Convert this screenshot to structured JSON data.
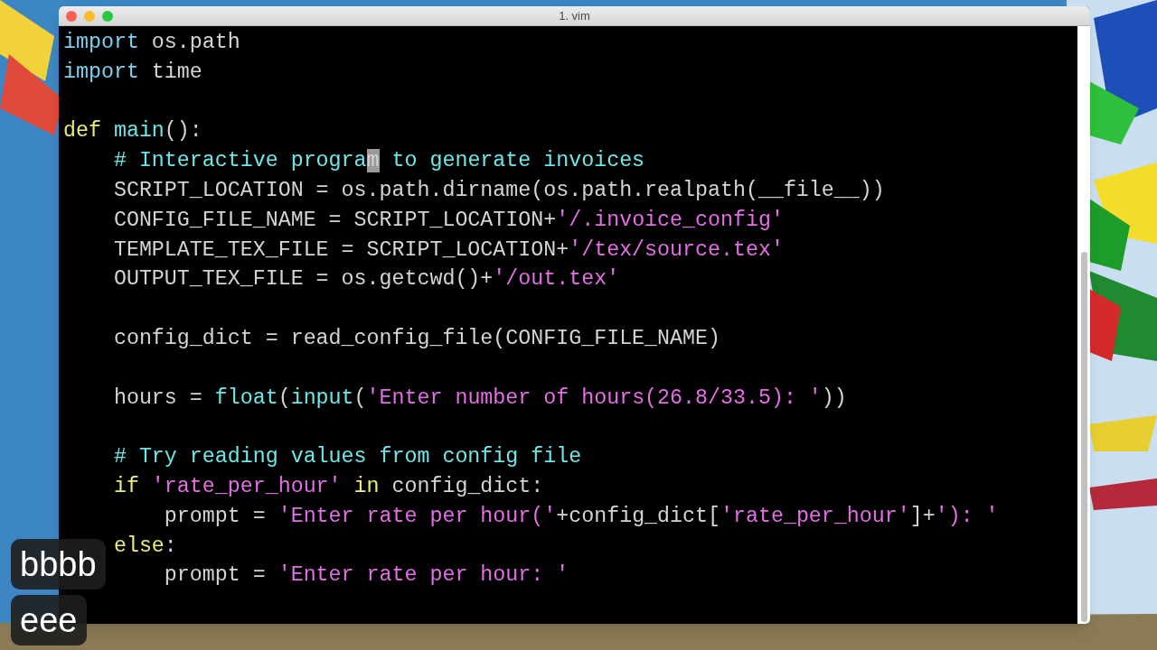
{
  "window": {
    "title": "1. vim"
  },
  "lines": [
    {
      "kind": "code",
      "tokens": [
        {
          "kind": "keyword",
          "s": "import"
        },
        {
          "kind": "plain",
          "s": " os.path"
        }
      ]
    },
    {
      "kind": "code",
      "tokens": [
        {
          "kind": "keyword",
          "s": "import"
        },
        {
          "kind": "plain",
          "s": " time"
        }
      ]
    },
    {
      "kind": "blank"
    },
    {
      "kind": "code",
      "tokens": [
        {
          "kind": "statement",
          "s": "def"
        },
        {
          "kind": "function",
          "s": " main"
        },
        {
          "kind": "plain",
          "s": "():"
        }
      ]
    },
    {
      "kind": "code",
      "tokens": [
        {
          "kind": "comment",
          "s": "    # Interactive progra"
        },
        {
          "kind": "cursor",
          "s": "m"
        },
        {
          "kind": "comment",
          "s": " to generate invoices"
        }
      ]
    },
    {
      "kind": "code",
      "tokens": [
        {
          "kind": "plain",
          "s": "    SCRIPT_LOCATION = os.path.dirname(os.path.realpath(__file__))"
        }
      ]
    },
    {
      "kind": "code",
      "tokens": [
        {
          "kind": "plain",
          "s": "    CONFIG_FILE_NAME = SCRIPT_LOCATION+"
        },
        {
          "kind": "string",
          "s": "'/.invoice_config'"
        }
      ]
    },
    {
      "kind": "code",
      "tokens": [
        {
          "kind": "plain",
          "s": "    TEMPLATE_TEX_FILE = SCRIPT_LOCATION+"
        },
        {
          "kind": "string",
          "s": "'/tex/source.tex'"
        }
      ]
    },
    {
      "kind": "code",
      "tokens": [
        {
          "kind": "plain",
          "s": "    OUTPUT_TEX_FILE = os.getcwd()+"
        },
        {
          "kind": "string",
          "s": "'/out.tex'"
        }
      ]
    },
    {
      "kind": "blank"
    },
    {
      "kind": "code",
      "tokens": [
        {
          "kind": "plain",
          "s": "    config_dict = read_config_file(CONFIG_FILE_NAME)"
        }
      ]
    },
    {
      "kind": "blank"
    },
    {
      "kind": "code",
      "tokens": [
        {
          "kind": "plain",
          "s": "    hours = "
        },
        {
          "kind": "function",
          "s": "float"
        },
        {
          "kind": "plain",
          "s": "("
        },
        {
          "kind": "function",
          "s": "input"
        },
        {
          "kind": "plain",
          "s": "("
        },
        {
          "kind": "string",
          "s": "'Enter number of hours(26.8/33.5): '"
        },
        {
          "kind": "plain",
          "s": "))"
        }
      ]
    },
    {
      "kind": "blank"
    },
    {
      "kind": "code",
      "tokens": [
        {
          "kind": "comment",
          "s": "    # Try reading values from config file"
        }
      ]
    },
    {
      "kind": "code",
      "tokens": [
        {
          "kind": "statement",
          "s": "    if"
        },
        {
          "kind": "string",
          "s": " 'rate_per_hour'"
        },
        {
          "kind": "statement",
          "s": " in"
        },
        {
          "kind": "plain",
          "s": " config_dict:"
        }
      ]
    },
    {
      "kind": "code",
      "tokens": [
        {
          "kind": "plain",
          "s": "        prompt = "
        },
        {
          "kind": "string",
          "s": "'Enter rate per hour('"
        },
        {
          "kind": "plain",
          "s": "+config_dict["
        },
        {
          "kind": "string",
          "s": "'rate_per_hour'"
        },
        {
          "kind": "plain",
          "s": "]+"
        },
        {
          "kind": "string",
          "s": "'): '"
        }
      ]
    },
    {
      "kind": "code",
      "tokens": [
        {
          "kind": "statement",
          "s": "    else"
        },
        {
          "kind": "plain",
          "s": ":"
        }
      ]
    },
    {
      "kind": "code",
      "tokens": [
        {
          "kind": "plain",
          "s": "        prompt = "
        },
        {
          "kind": "string",
          "s": "'Enter rate per hour: '"
        }
      ]
    }
  ],
  "keystrokes": [
    "bbbb",
    "eee"
  ]
}
